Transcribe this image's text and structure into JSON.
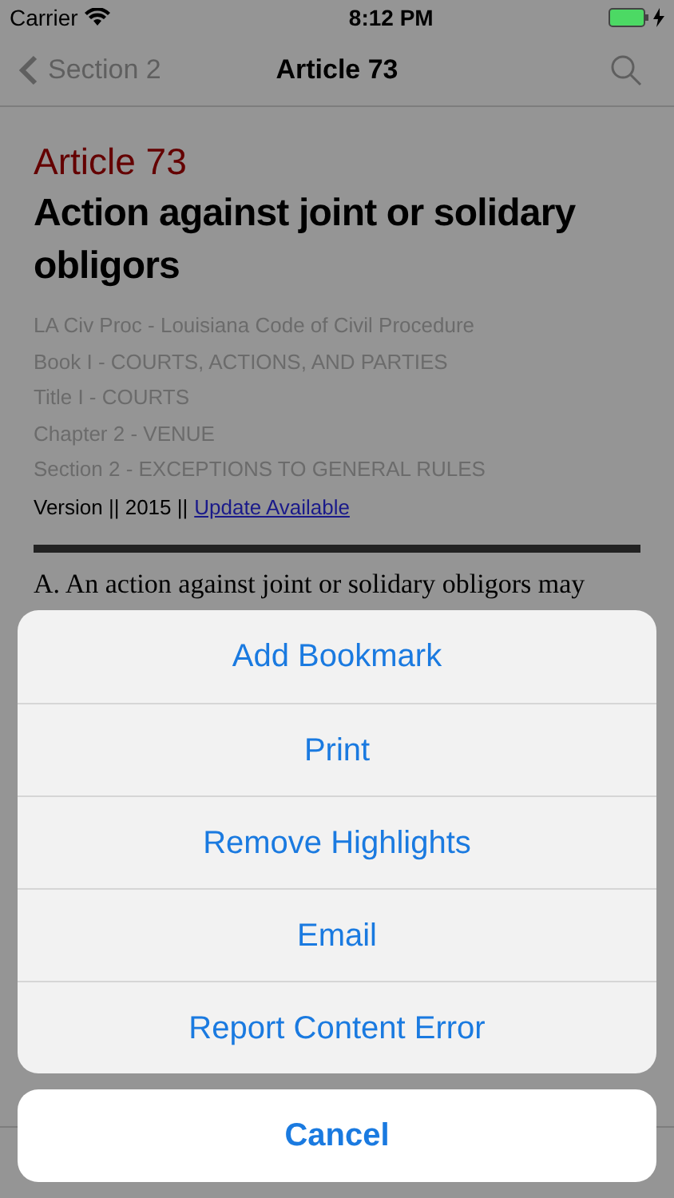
{
  "status_bar": {
    "carrier": "Carrier",
    "time": "8:12 PM",
    "battery_charging": true
  },
  "nav_bar": {
    "back_label": "Section 2",
    "title": "Article 73"
  },
  "article": {
    "number": "Article 73",
    "title": "Action against joint or solidary obligors",
    "breadcrumbs": [
      "LA Civ Proc - Louisiana Code of Civil Procedure",
      "Book I - COURTS, ACTIONS, AND PARTIES",
      "Title I - COURTS",
      "Chapter 2 - VENUE",
      "Section 2 - EXCEPTIONS TO GENERAL RULES"
    ],
    "version_text": "Version || 2015 ||",
    "update_link": "Update Available",
    "body_lines": [
      "A.  An action against joint or solidary obligors may"
    ]
  },
  "action_sheet": {
    "actions": [
      "Add Bookmark",
      "Print",
      "Remove Highlights",
      "Email",
      "Report Content Error"
    ],
    "cancel": "Cancel"
  }
}
